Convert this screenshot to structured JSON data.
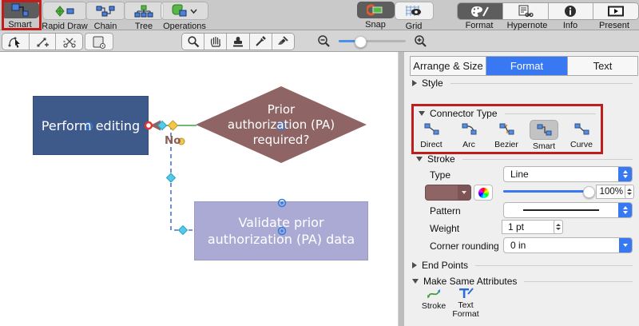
{
  "toolbar": {
    "diagram_buttons": [
      {
        "label": "Smart",
        "selected": true,
        "highlighted": true
      },
      {
        "label": "Rapid Draw"
      },
      {
        "label": "Chain"
      },
      {
        "label": "Tree"
      },
      {
        "label": "Operations",
        "has_dropdown": true
      }
    ],
    "snap_label": "Snap",
    "grid_label": "Grid",
    "panel_buttons": [
      {
        "label": "Format",
        "selected": true
      },
      {
        "label": "Hypernote"
      },
      {
        "label": "Info"
      },
      {
        "label": "Present"
      }
    ]
  },
  "canvas": {
    "process_box": {
      "label": "Perform editing",
      "fill": "#3d5a8a"
    },
    "decision_diamond": {
      "line1": "Prior",
      "line2": "authorization (PA)",
      "line3": "required?",
      "fill": "#8e6465"
    },
    "validate_box": {
      "line1": "Validate prior",
      "line2": "authorization (PA) data",
      "fill": "#abaad5"
    },
    "connector_label": "No"
  },
  "panel": {
    "tabs": [
      {
        "label": "Arrange & Size"
      },
      {
        "label": "Format",
        "selected": true
      },
      {
        "label": "Text"
      }
    ],
    "style_section": {
      "title": "Style",
      "collapsed": true
    },
    "connector_type": {
      "title": "Connector Type",
      "highlighted": true,
      "options": [
        {
          "label": "Direct"
        },
        {
          "label": "Arc"
        },
        {
          "label": "Bezier"
        },
        {
          "label": "Smart",
          "selected": true
        },
        {
          "label": "Curve"
        }
      ]
    },
    "stroke": {
      "title": "Stroke",
      "type_label": "Type",
      "type_value": "Line",
      "opacity_value": "100%",
      "pattern_label": "Pattern",
      "weight_label": "Weight",
      "weight_value": "1 pt",
      "corner_label": "Corner rounding",
      "corner_value": "0 in",
      "color_hex": "#8e6465"
    },
    "end_points": {
      "title": "End Points",
      "collapsed": true
    },
    "make_same": {
      "title": "Make Same Attributes",
      "stroke_label": "Stroke",
      "text_format_label": "Text Format"
    }
  },
  "accent_colors": {
    "tab_selected_blue": "#3878f2",
    "annotation_red": "#bf1f1c",
    "selection_dash_blue": "#5270d8",
    "connector_green": "#43a047"
  }
}
